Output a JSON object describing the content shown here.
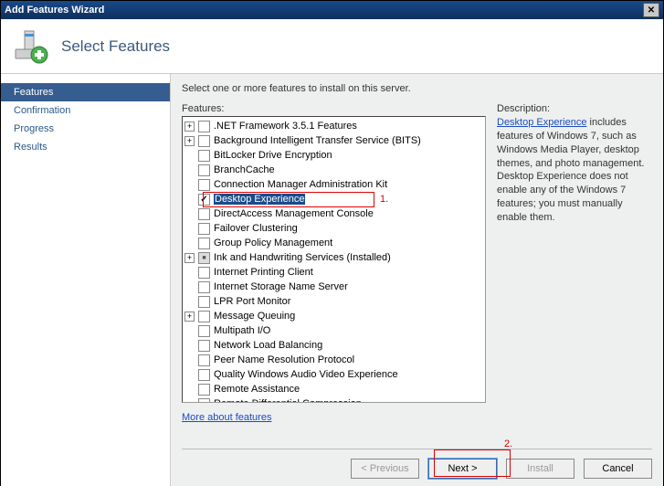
{
  "window": {
    "title": "Add Features Wizard"
  },
  "header": {
    "title": "Select Features"
  },
  "sidebar": {
    "items": [
      {
        "label": "Features",
        "active": true
      },
      {
        "label": "Confirmation",
        "active": false
      },
      {
        "label": "Progress",
        "active": false
      },
      {
        "label": "Results",
        "active": false
      }
    ]
  },
  "main": {
    "instruction": "Select one or more features to install on this server.",
    "features_label": "Features:",
    "description_label": "Description:",
    "desc_link": "Desktop Experience",
    "desc_text": " includes features of Windows 7, such as Windows Media Player, desktop themes, and photo management. Desktop Experience does not enable any of the Windows 7 features; you must manually enable them.",
    "more_link": "More about features",
    "features": [
      {
        "label": ".NET Framework 3.5.1 Features",
        "expandable": true,
        "state": "unchecked",
        "selected": false
      },
      {
        "label": "Background Intelligent Transfer Service (BITS)",
        "expandable": true,
        "state": "unchecked",
        "selected": false
      },
      {
        "label": "BitLocker Drive Encryption",
        "expandable": false,
        "state": "unchecked",
        "selected": false
      },
      {
        "label": "BranchCache",
        "expandable": false,
        "state": "unchecked",
        "selected": false
      },
      {
        "label": "Connection Manager Administration Kit",
        "expandable": false,
        "state": "unchecked",
        "selected": false
      },
      {
        "label": "Desktop Experience",
        "expandable": false,
        "state": "checked",
        "selected": true
      },
      {
        "label": "DirectAccess Management Console",
        "expandable": false,
        "state": "unchecked",
        "selected": false
      },
      {
        "label": "Failover Clustering",
        "expandable": false,
        "state": "unchecked",
        "selected": false
      },
      {
        "label": "Group Policy Management",
        "expandable": false,
        "state": "unchecked",
        "selected": false
      },
      {
        "label": "Ink and Handwriting Services  (Installed)",
        "expandable": true,
        "state": "partial",
        "selected": false
      },
      {
        "label": "Internet Printing Client",
        "expandable": false,
        "state": "unchecked",
        "selected": false
      },
      {
        "label": "Internet Storage Name Server",
        "expandable": false,
        "state": "unchecked",
        "selected": false
      },
      {
        "label": "LPR Port Monitor",
        "expandable": false,
        "state": "unchecked",
        "selected": false
      },
      {
        "label": "Message Queuing",
        "expandable": true,
        "state": "unchecked",
        "selected": false
      },
      {
        "label": "Multipath I/O",
        "expandable": false,
        "state": "unchecked",
        "selected": false
      },
      {
        "label": "Network Load Balancing",
        "expandable": false,
        "state": "unchecked",
        "selected": false
      },
      {
        "label": "Peer Name Resolution Protocol",
        "expandable": false,
        "state": "unchecked",
        "selected": false
      },
      {
        "label": "Quality Windows Audio Video Experience",
        "expandable": false,
        "state": "unchecked",
        "selected": false
      },
      {
        "label": "Remote Assistance",
        "expandable": false,
        "state": "unchecked",
        "selected": false
      },
      {
        "label": "Remote Differential Compression",
        "expandable": false,
        "state": "unchecked",
        "selected": false
      }
    ]
  },
  "buttons": {
    "previous": "< Previous",
    "next": "Next >",
    "install": "Install",
    "cancel": "Cancel"
  },
  "annotations": {
    "a1": "1.",
    "a2": "2."
  }
}
